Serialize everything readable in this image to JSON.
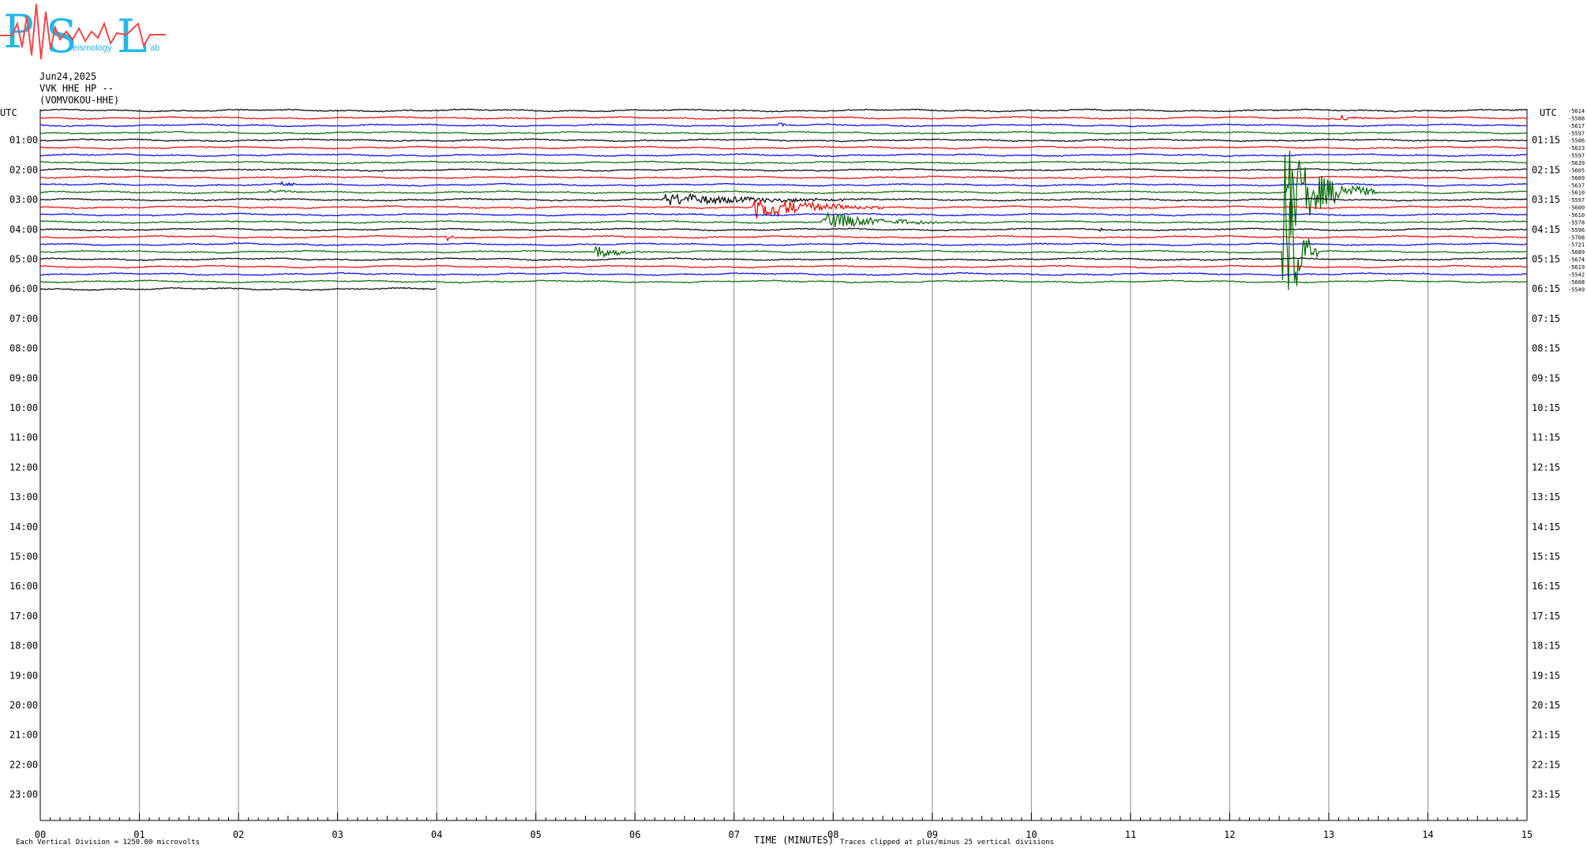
{
  "logo": {
    "letters": [
      "P",
      "S",
      "L"
    ],
    "words": [
      "eismology",
      "ab"
    ]
  },
  "header": {
    "date": "Jun24,2025",
    "station": "VVK HHE HP --",
    "channel": "(VOMVOKOU-HHE)"
  },
  "footer": {
    "left_note": "Each Vertical Division = 1250.00 microvolts",
    "x_title": "TIME (MINUTES)",
    "clip_note": "Traces clipped at plus/minus 25 vertical divisions"
  },
  "chart_data": {
    "type": "line",
    "title": "",
    "xlabel": "TIME (MINUTES)",
    "ylabel": "UTC",
    "xlim": [
      0,
      15
    ],
    "x_ticks": [
      "00",
      "01",
      "02",
      "03",
      "04",
      "05",
      "06",
      "07",
      "08",
      "09",
      "10",
      "11",
      "12",
      "13",
      "14",
      "15"
    ],
    "left_axis_title": "UTC",
    "right_axis_title": "UTC",
    "left_hour_labels": [
      "01:00",
      "02:00",
      "03:00",
      "04:00",
      "05:00",
      "06:00",
      "07:00",
      "08:00",
      "09:00",
      "10:00",
      "11:00",
      "12:00",
      "13:00",
      "14:00",
      "15:00",
      "16:00",
      "17:00",
      "18:00",
      "19:00",
      "20:00",
      "21:00",
      "22:00",
      "23:00"
    ],
    "right_hour_labels": [
      "01:15",
      "02:15",
      "03:15",
      "04:15",
      "05:15",
      "06:15",
      "07:15",
      "08:15",
      "09:15",
      "10:15",
      "11:15",
      "12:15",
      "13:15",
      "14:15",
      "15:15",
      "16:15",
      "17:15",
      "18:15",
      "19:15",
      "20:15",
      "21:15",
      "22:15",
      "23:15"
    ],
    "trace_colors": [
      "#000000",
      "#ee0000",
      "#0000ee",
      "#006600"
    ],
    "trace_count": 25,
    "trace_offsets": [
      "-5614",
      "-5588",
      "-5617",
      "-5597",
      "-5586",
      "-5623",
      "-5597",
      "-5639",
      "-5605",
      "-5609",
      "-5637",
      "-5610",
      "-5597",
      "-5600",
      "-5610",
      "-5578",
      "-5596",
      "-5708",
      "-5721",
      "-5689",
      "-5674",
      "-5619",
      "-5542",
      "-5608",
      "-5549"
    ],
    "last_trace_end_minute": 4.0,
    "events": [
      {
        "trace": 1,
        "minute": 13.1,
        "amplitude": 5,
        "duration": 0.4
      },
      {
        "trace": 2,
        "minute": 7.45,
        "amplitude": 4,
        "duration": 0.2
      },
      {
        "trace": 10,
        "minute": 2.45,
        "amplitude": 9,
        "duration": 0.15
      },
      {
        "trace": 11,
        "minute": 2.3,
        "amplitude": 3,
        "duration": 0.4
      },
      {
        "trace": 12,
        "minute": 6.3,
        "amplitude": 8,
        "duration": 2.7
      },
      {
        "trace": 13,
        "minute": 7.2,
        "amplitude": 18,
        "duration": 1.4
      },
      {
        "trace": 11,
        "minute": 12.6,
        "amplitude": 60,
        "duration": 0.9
      },
      {
        "trace": 15,
        "minute": 7.9,
        "amplitude": 12,
        "duration": 1.5
      },
      {
        "trace": 17,
        "minute": 4.1,
        "amplitude": 7,
        "duration": 0.15
      },
      {
        "trace": 18,
        "minute": 1.95,
        "amplitude": 3,
        "duration": 0.1
      },
      {
        "trace": 19,
        "minute": 5.6,
        "amplitude": 10,
        "duration": 0.6
      },
      {
        "trace": 19,
        "minute": 12.55,
        "amplitude": 140,
        "duration": 0.35
      },
      {
        "trace": 16,
        "minute": 10.7,
        "amplitude": 4,
        "duration": 0.05
      }
    ]
  }
}
